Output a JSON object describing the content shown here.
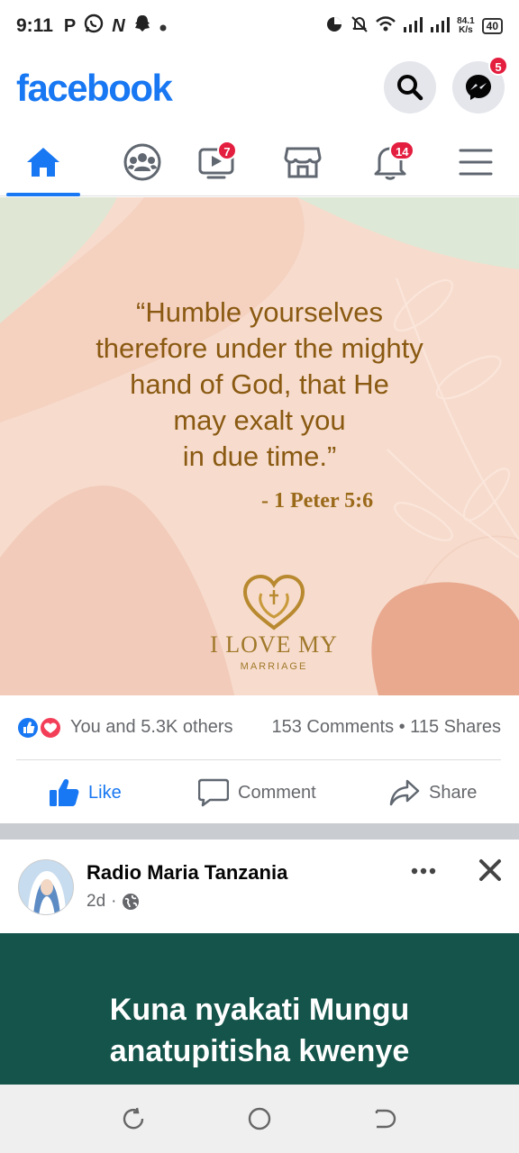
{
  "status_bar": {
    "time": "9:11",
    "left_icons": [
      "p-icon",
      "whatsapp-icon",
      "n-icon",
      "snapchat-icon",
      "dot-icon"
    ],
    "left_glyphs": [
      "P",
      "N"
    ],
    "net_speed_value": "84.1",
    "net_speed_unit": "K/s",
    "battery": "40"
  },
  "header": {
    "logo": "facebook",
    "messenger_badge": "5"
  },
  "tabs": {
    "watch_badge": "7",
    "notifications_badge": "14"
  },
  "post1": {
    "quote_lines": [
      "“Humble yourselves",
      "therefore under the mighty",
      "hand of God, that He",
      "may exalt you",
      "in due time.”"
    ],
    "reference": "- 1 Peter 5:6",
    "brand_name": "I LOVE MY",
    "brand_sub": "MARRIAGE",
    "reactions_text": "You and 5.3K others",
    "counts_text": "153 Comments • 115 Shares",
    "like_label": "Like",
    "comment_label": "Comment",
    "share_label": "Share"
  },
  "post2": {
    "page_name": "Radio Maria Tanzania",
    "time_ago": "2d",
    "dot": "·",
    "text_lines": [
      "Kuna nyakati Mungu",
      "anatupitisha kwenye"
    ]
  },
  "colors": {
    "brand_blue": "#1877f2",
    "badge_red": "#e41e3f",
    "quote_gold": "#8a5a12",
    "post2_bg": "#14544a"
  }
}
